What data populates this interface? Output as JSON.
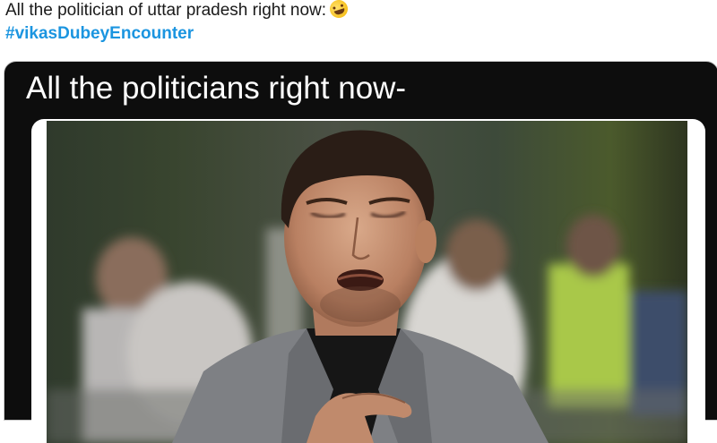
{
  "tweet": {
    "text": "All the politician of uttar pradesh right now:",
    "emoji_icon": "rolling-on-floor-laughing-emoji",
    "hashtag": "#vikasDubeyEncounter"
  },
  "meme": {
    "caption": "All the politicians right now-"
  },
  "colors": {
    "hashtag": "#1b95e0",
    "card_background": "#0d0d0d",
    "caption_text": "#ffffff"
  }
}
